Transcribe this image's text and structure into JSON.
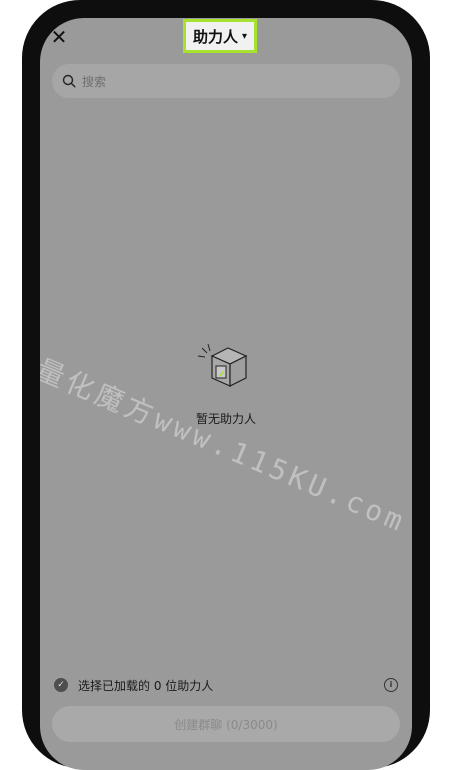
{
  "header": {
    "close_icon": "✕",
    "title": "助力人",
    "caret_icon": "▾"
  },
  "search": {
    "placeholder": "搜索"
  },
  "empty_state": {
    "icon": "empty-box-icon",
    "message": "暂无助力人"
  },
  "watermark": {
    "text": "量化魔方www.115KU.com"
  },
  "selection": {
    "check_icon": "✓",
    "label": "选择已加载的 0 位助力人",
    "info_icon": "i"
  },
  "action": {
    "create_label": "创建群聊 (0/3000)"
  },
  "colors": {
    "overlay": "#9a9a9a",
    "highlight": "#a6e22e",
    "frame": "#0e0e0e"
  }
}
